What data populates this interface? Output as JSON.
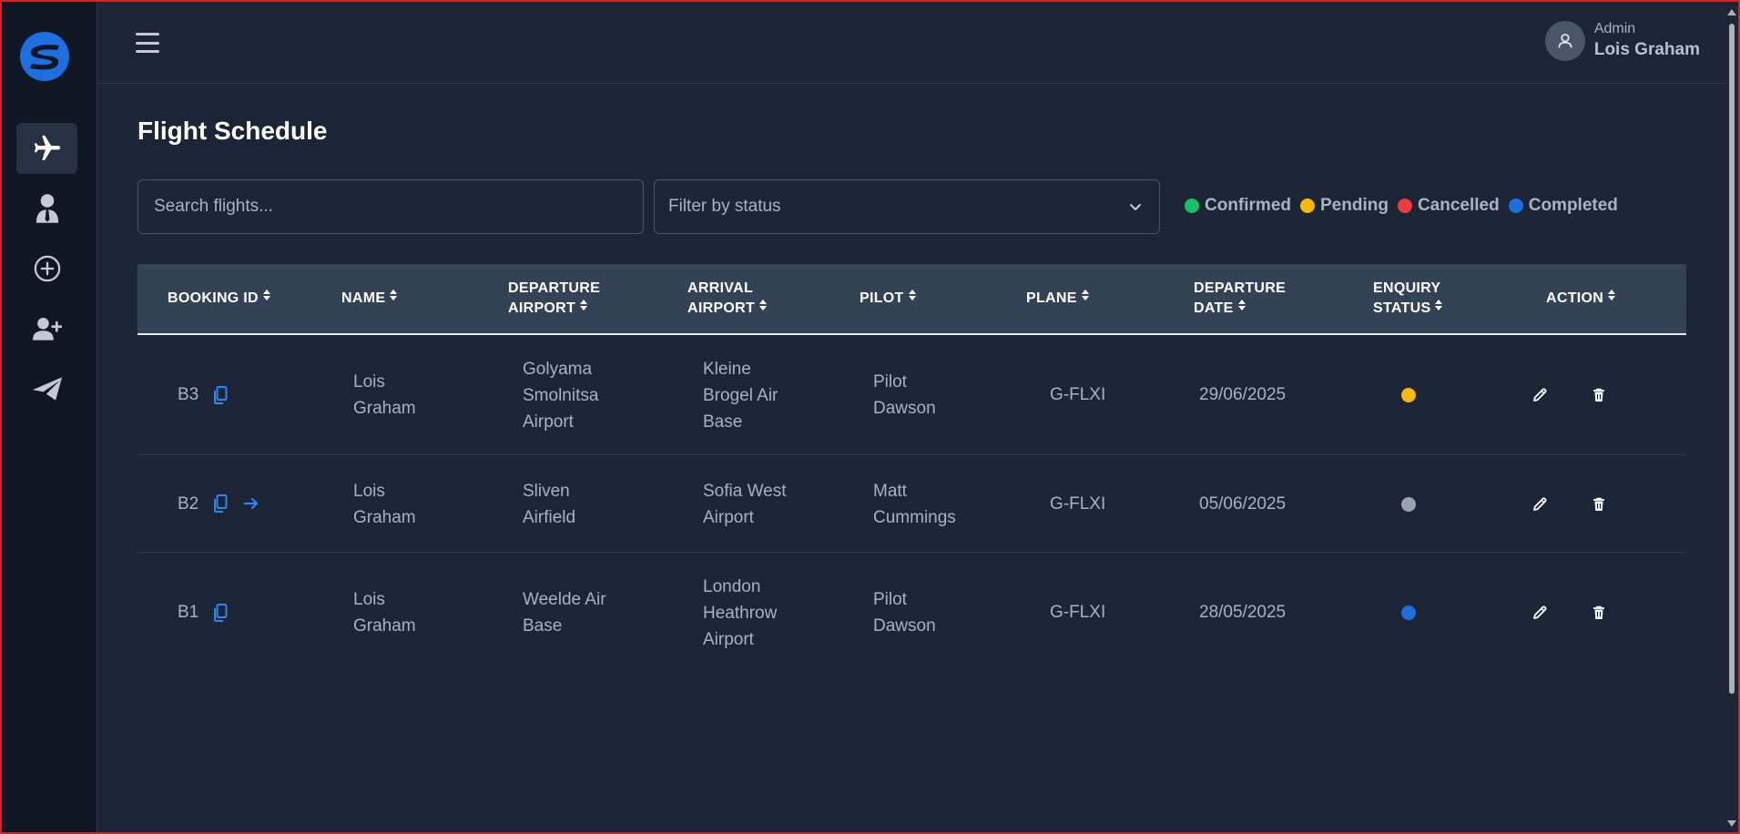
{
  "header": {
    "user_role": "Admin",
    "user_name": "Lois Graham"
  },
  "sidebar": {
    "items": [
      {
        "icon": "plane-icon",
        "active": true
      },
      {
        "icon": "user-tie-icon",
        "active": false
      },
      {
        "icon": "plus-circle-icon",
        "active": false
      },
      {
        "icon": "user-plus-icon",
        "active": false
      },
      {
        "icon": "paper-plane-icon",
        "active": false
      }
    ]
  },
  "page": {
    "title": "Flight Schedule",
    "search_placeholder": "Search flights...",
    "filter_placeholder": "Filter by status"
  },
  "legend": [
    {
      "label": "Confirmed",
      "color": "#16c163"
    },
    {
      "label": "Pending",
      "color": "#f5b80b"
    },
    {
      "label": "Cancelled",
      "color": "#ef3b3b"
    },
    {
      "label": "Completed",
      "color": "#1d6fe0"
    }
  ],
  "table": {
    "columns": [
      {
        "line1": "BOOKING ID",
        "line2": ""
      },
      {
        "line1": "NAME",
        "line2": ""
      },
      {
        "line1": "DEPARTURE",
        "line2": "AIRPORT"
      },
      {
        "line1": "ARRIVAL",
        "line2": "AIRPORT"
      },
      {
        "line1": "PILOT",
        "line2": ""
      },
      {
        "line1": "PLANE",
        "line2": ""
      },
      {
        "line1": "DEPARTURE",
        "line2": "DATE"
      },
      {
        "line1": "ENQUIRY",
        "line2": "STATUS"
      },
      {
        "line1": "ACTION",
        "line2": ""
      }
    ],
    "rows": [
      {
        "booking_id": "B3",
        "name": [
          "Lois",
          "Graham"
        ],
        "departure": [
          "Golyama",
          "Smolnitsa",
          "Airport"
        ],
        "arrival": [
          "Kleine",
          "Brogel Air",
          "Base"
        ],
        "pilot": [
          "Pilot",
          "Dawson"
        ],
        "plane": "G-FLXI",
        "date": "29/06/2025",
        "status_color": "#f5b80b",
        "has_arrow": false
      },
      {
        "booking_id": "B2",
        "name": [
          "Lois",
          "Graham"
        ],
        "departure": [
          "Sliven",
          "Airfield"
        ],
        "arrival": [
          "Sofia West",
          "Airport"
        ],
        "pilot": [
          "Matt",
          "Cummings"
        ],
        "plane": "G-FLXI",
        "date": "05/06/2025",
        "status_color": "#9aa2ad",
        "has_arrow": true
      },
      {
        "booking_id": "B1",
        "name": [
          "Lois",
          "Graham"
        ],
        "departure": [
          "Weelde Air",
          "Base"
        ],
        "arrival": [
          "London",
          "Heathrow",
          "Airport"
        ],
        "pilot": [
          "Pilot",
          "Dawson"
        ],
        "plane": "G-FLXI",
        "date": "28/05/2025",
        "status_color": "#1d6fe0",
        "has_arrow": false
      }
    ]
  }
}
